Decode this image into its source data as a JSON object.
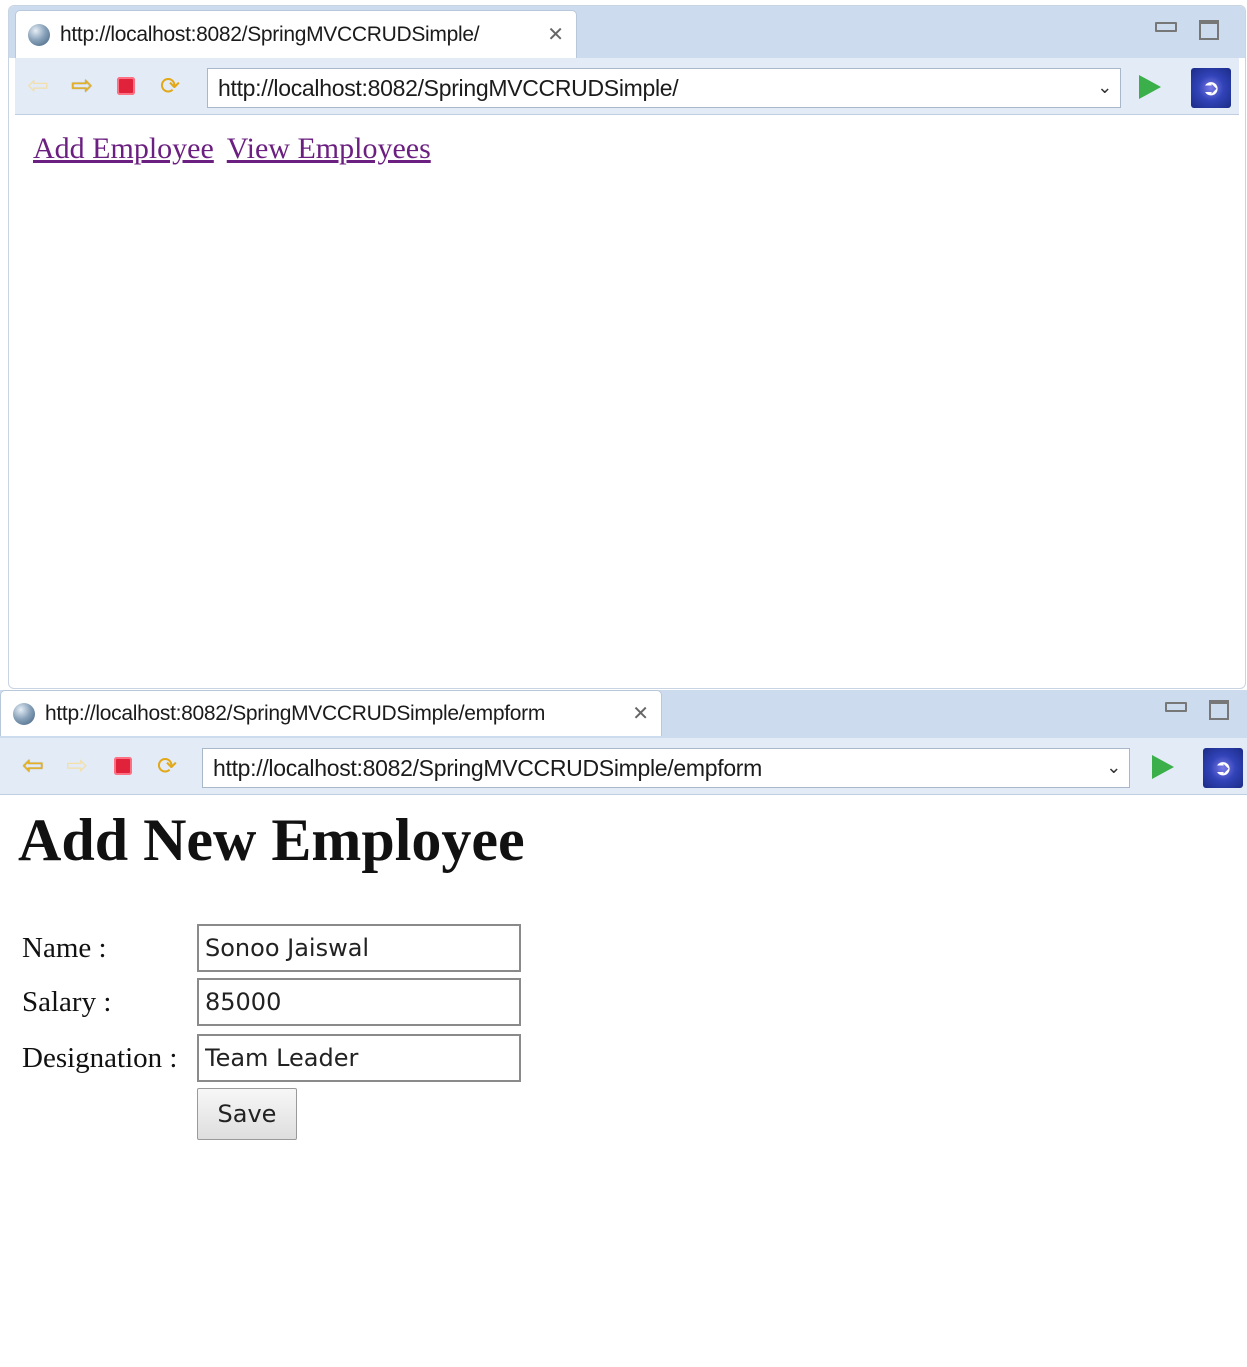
{
  "window1": {
    "tab_title": "http://localhost:8082/SpringMVCCRUDSimple/",
    "url": "http://localhost:8082/SpringMVCCRUDSimple/",
    "links": [
      {
        "label": "Add Employee"
      },
      {
        "label": "View Employees"
      }
    ]
  },
  "window2": {
    "tab_title": "http://localhost:8082/SpringMVCCRUDSimple/empform",
    "url": "http://localhost:8082/SpringMVCCRUDSimple/empform",
    "heading": "Add New Employee",
    "form": {
      "name_label": "Name :",
      "name_value": "Sonoo Jaiswal",
      "salary_label": "Salary :",
      "salary_value": "85000",
      "designation_label": "Designation :",
      "designation_value": "Team Leader",
      "save_label": "Save"
    }
  },
  "icons": {
    "tab": "globe-icon",
    "close": "close-tab-icon",
    "back": "back-arrow-icon",
    "forward": "forward-arrow-icon",
    "stop": "stop-icon",
    "refresh": "refresh-icon",
    "dropdown": "chevron-down-icon",
    "go": "go-play-icon",
    "external": "external-browser-icon"
  },
  "colors": {
    "link_visited": "#6b1f80",
    "go_green": "#3bb04a",
    "stop_red": "#e0233b",
    "tabbar_bg": "#ccdcee"
  }
}
